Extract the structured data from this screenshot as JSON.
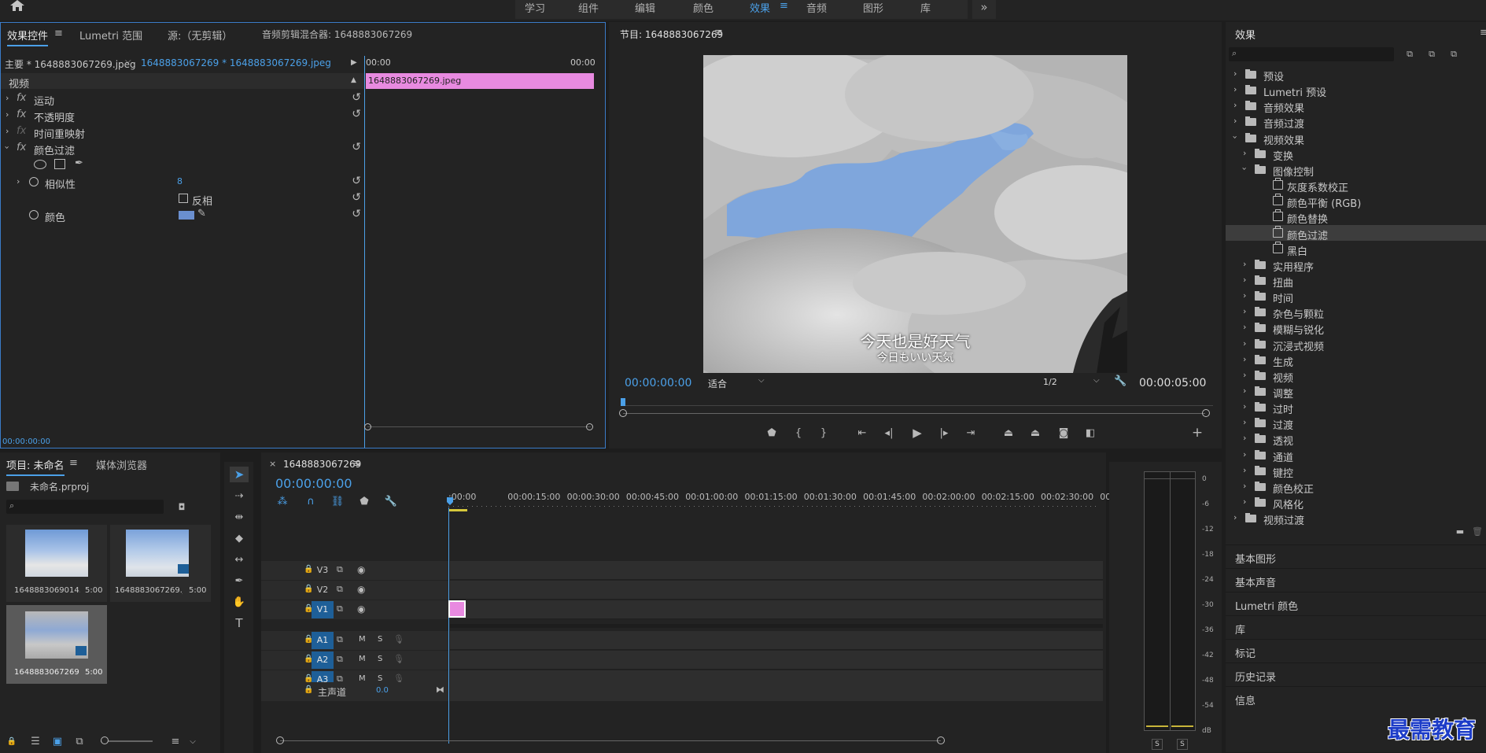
{
  "workspaces": [
    "学习",
    "组件",
    "编辑",
    "颜色",
    "效果",
    "音频",
    "图形",
    "库"
  ],
  "workspace_more": "»",
  "ec": {
    "tabs": [
      "效果控件",
      "Lumetri 范围",
      "源:（无剪辑）",
      "音频剪辑混合器: 1648883067269"
    ],
    "master": "主要 * 1648883067269.jpeg",
    "seq": "1648883067269 * 1648883067269.jpeg",
    "section": "视频",
    "rows": [
      "运动",
      "不透明度",
      "时间重映射",
      "颜色过滤"
    ],
    "fx_label": "fx",
    "similarity_label": "相似性",
    "similarity_value": "8",
    "invert_label": "反相",
    "color_label": "颜色",
    "time_start": "00:00",
    "time_end": "00:00",
    "clip": "1648883067269.jpeg",
    "timecode": "00:00:00:00"
  },
  "program": {
    "title": "节目: 1648883067269",
    "subtitle_cn": "今天也是好天气",
    "subtitle_jp": "今日もいい天気",
    "timecode": "00:00:00:00",
    "fit": "适合",
    "quality": "1/2",
    "duration": "00:00:05:00"
  },
  "effects": {
    "title": "效果",
    "tree": [
      {
        "t": "预设",
        "lvl": 0,
        "k": "folder",
        "open": false
      },
      {
        "t": "Lumetri 预设",
        "lvl": 0,
        "k": "folder",
        "open": false
      },
      {
        "t": "音频效果",
        "lvl": 0,
        "k": "folder",
        "open": false
      },
      {
        "t": "音频过渡",
        "lvl": 0,
        "k": "folder",
        "open": false
      },
      {
        "t": "视频效果",
        "lvl": 0,
        "k": "folder",
        "open": true
      },
      {
        "t": "变换",
        "lvl": 1,
        "k": "folder",
        "open": false
      },
      {
        "t": "图像控制",
        "lvl": 1,
        "k": "folder",
        "open": true
      },
      {
        "t": "灰度系数校正",
        "lvl": 2,
        "k": "fx"
      },
      {
        "t": "颜色平衡 (RGB)",
        "lvl": 2,
        "k": "fx"
      },
      {
        "t": "颜色替换",
        "lvl": 2,
        "k": "fx"
      },
      {
        "t": "颜色过滤",
        "lvl": 2,
        "k": "fx",
        "sel": true
      },
      {
        "t": "黑白",
        "lvl": 2,
        "k": "fx"
      },
      {
        "t": "实用程序",
        "lvl": 1,
        "k": "folder",
        "open": false
      },
      {
        "t": "扭曲",
        "lvl": 1,
        "k": "folder",
        "open": false
      },
      {
        "t": "时间",
        "lvl": 1,
        "k": "folder",
        "open": false
      },
      {
        "t": "杂色与颗粒",
        "lvl": 1,
        "k": "folder",
        "open": false
      },
      {
        "t": "模糊与锐化",
        "lvl": 1,
        "k": "folder",
        "open": false
      },
      {
        "t": "沉浸式视频",
        "lvl": 1,
        "k": "folder",
        "open": false
      },
      {
        "t": "生成",
        "lvl": 1,
        "k": "folder",
        "open": false
      },
      {
        "t": "视频",
        "lvl": 1,
        "k": "folder",
        "open": false
      },
      {
        "t": "调整",
        "lvl": 1,
        "k": "folder",
        "open": false
      },
      {
        "t": "过时",
        "lvl": 1,
        "k": "folder",
        "open": false
      },
      {
        "t": "过渡",
        "lvl": 1,
        "k": "folder",
        "open": false
      },
      {
        "t": "透视",
        "lvl": 1,
        "k": "folder",
        "open": false
      },
      {
        "t": "通道",
        "lvl": 1,
        "k": "folder",
        "open": false
      },
      {
        "t": "键控",
        "lvl": 1,
        "k": "folder",
        "open": false
      },
      {
        "t": "颜色校正",
        "lvl": 1,
        "k": "folder",
        "open": false
      },
      {
        "t": "风格化",
        "lvl": 1,
        "k": "folder",
        "open": false
      },
      {
        "t": "视频过渡",
        "lvl": 0,
        "k": "folder",
        "open": false
      }
    ],
    "sections": [
      "基本图形",
      "基本声音",
      "Lumetri 颜色",
      "库",
      "标记",
      "历史记录",
      "信息"
    ]
  },
  "project": {
    "tabs": [
      "项目: 未命名",
      "媒体浏览器"
    ],
    "file": "未命名.prproj",
    "items": [
      {
        "name": "1648883069014.jp...",
        "dur": "5:00"
      },
      {
        "name": "1648883067269.jp...",
        "dur": "5:00"
      },
      {
        "name": "1648883067269",
        "dur": "5:00"
      }
    ]
  },
  "timeline": {
    "tab": "1648883067269",
    "close": "×",
    "timecode": "00:00:00:00",
    "ticks": [
      ":00:00",
      "00:00:15:00",
      "00:00:30:00",
      "00:00:45:00",
      "00:01:00:00",
      "00:01:15:00",
      "00:01:30:00",
      "00:01:45:00",
      "00:02:00:00",
      "00:02:15:00",
      "00:02:30:00",
      "00:02:45:"
    ],
    "tracks": [
      "V3",
      "V2",
      "V1",
      "A1",
      "A2",
      "A3"
    ],
    "m": "M",
    "s": "S",
    "master": "主声道",
    "master_val": "0.0"
  },
  "meter": {
    "db": [
      "0",
      "-6",
      "-12",
      "-18",
      "-24",
      "-30",
      "-36",
      "-42",
      "-48",
      "-54",
      "dB"
    ],
    "s": "S"
  },
  "watermark": "最需教育",
  "colors": {
    "accent": "#4ba0e8",
    "clip": "#e88ae0",
    "track_on": "#1e5f98"
  }
}
